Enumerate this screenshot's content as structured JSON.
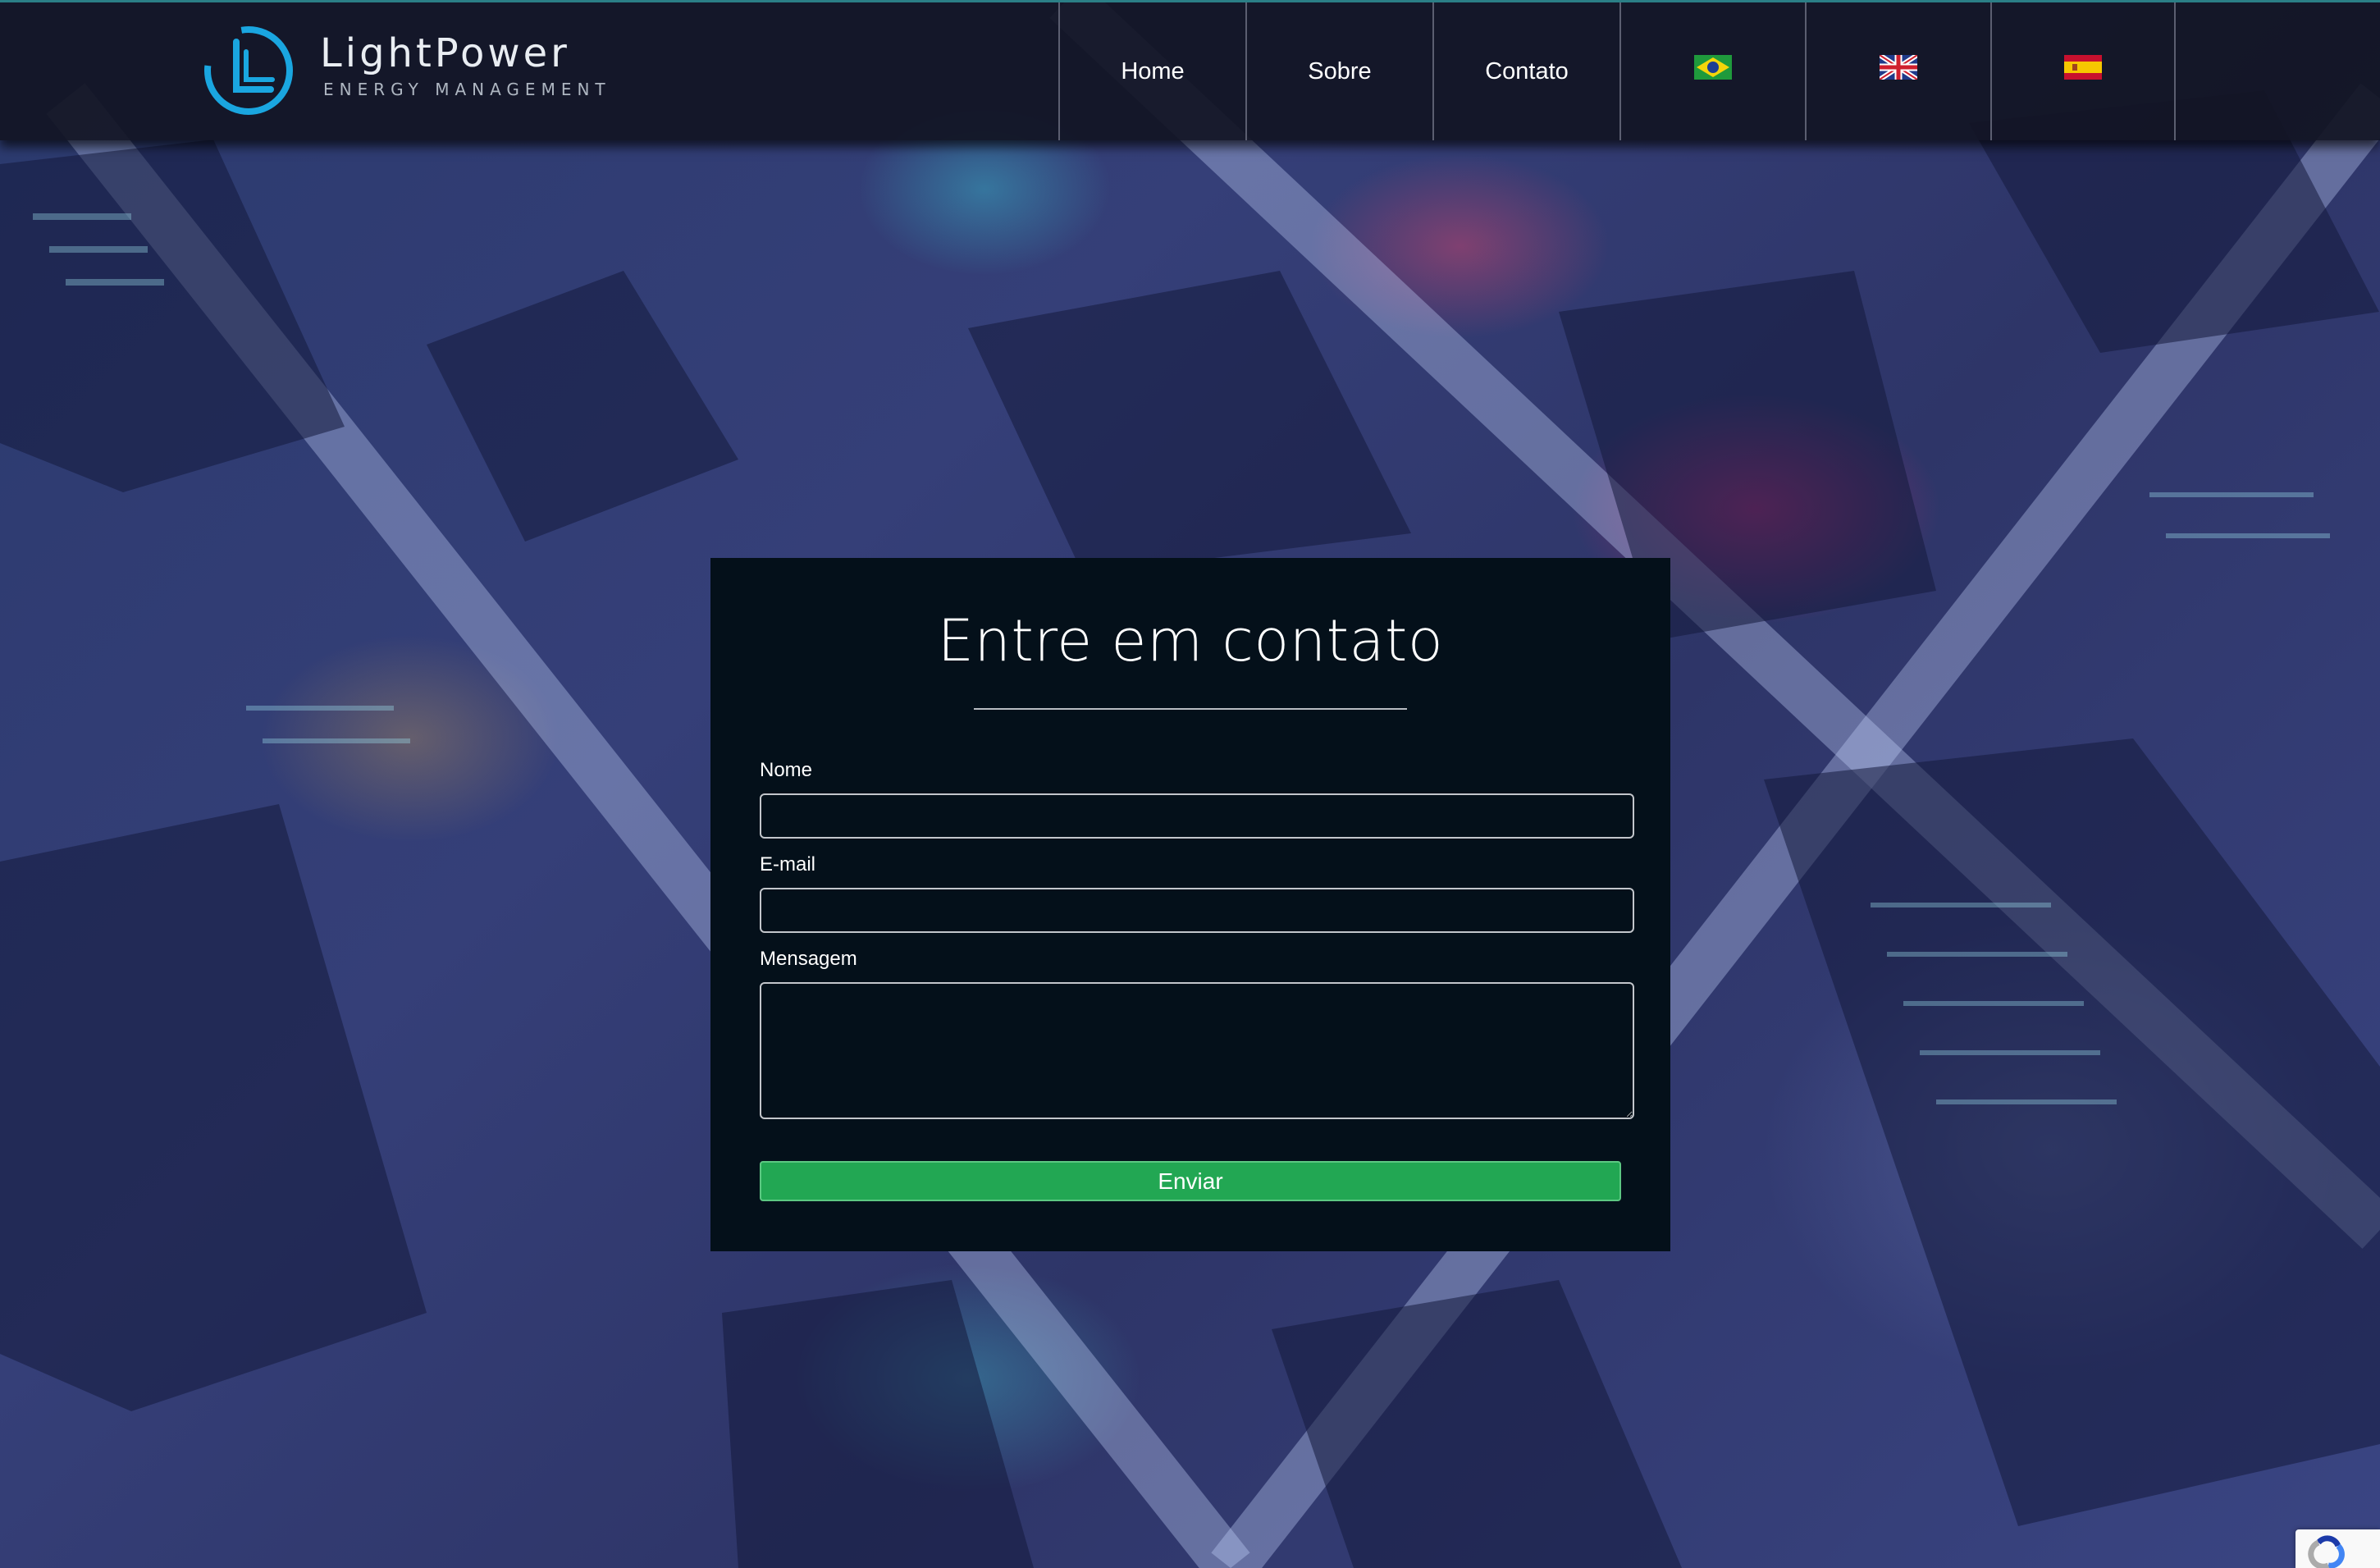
{
  "brand": {
    "name": "LightPower",
    "tagline": "ENERGY MANAGEMENT",
    "accent_color": "#1aa6e0"
  },
  "nav": {
    "items": [
      {
        "label": "Home"
      },
      {
        "label": "Sobre"
      },
      {
        "label": "Contato"
      }
    ],
    "languages": [
      {
        "flag": "brazil-flag-icon"
      },
      {
        "flag": "uk-flag-icon"
      },
      {
        "flag": "spain-flag-icon"
      }
    ]
  },
  "contact_form": {
    "title": "Entre em contato",
    "name_label": "Nome",
    "name_value": "",
    "email_label": "E-mail",
    "email_value": "",
    "message_label": "Mensagem",
    "message_value": "",
    "submit_label": "Enviar",
    "submit_color": "#22a753"
  },
  "recaptcha_badge": {
    "icon": "recaptcha-icon"
  }
}
